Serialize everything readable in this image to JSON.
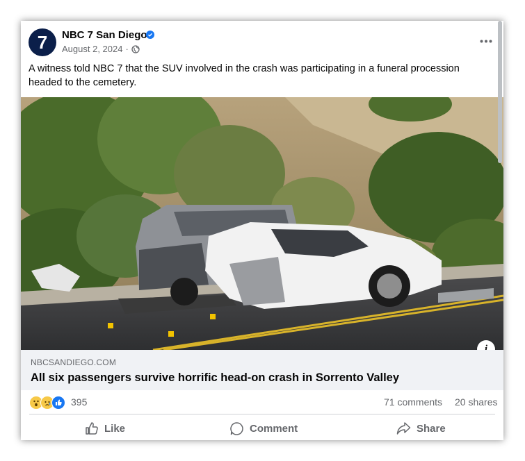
{
  "post": {
    "page_name": "NBC 7 San Diego",
    "avatar_text": "7",
    "date": "August 2, 2024",
    "separator": "·",
    "caption": "A witness told NBC 7 that the SUV involved in the crash was participating in a funeral procession headed to the cemetery.",
    "icons": {
      "verified": "verified-badge-icon",
      "privacy": "globe-icon",
      "more": "more-options-icon"
    }
  },
  "image": {
    "description_icon": "info-icon",
    "info_label": "i"
  },
  "link_preview": {
    "domain": "NBCSANDIEGO.COM",
    "title": "All six passengers survive horrific head-on crash in Sorrento Valley"
  },
  "stats": {
    "reaction_icons": [
      "wow-reaction-icon",
      "sad-reaction-icon",
      "like-reaction-icon"
    ],
    "reaction_count": "395",
    "comments": "71 comments",
    "shares": "20 shares"
  },
  "actions": {
    "like": "Like",
    "comment": "Comment",
    "share": "Share"
  },
  "colors": {
    "accent": "#1877f2",
    "secondary_text": "#65676b",
    "link_bg": "#f0f2f5"
  }
}
